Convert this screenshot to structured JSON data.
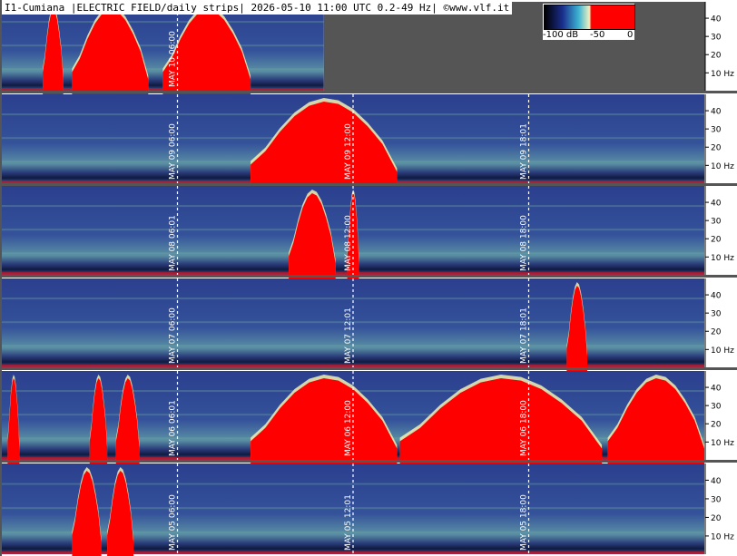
{
  "header": {
    "title": "I1-Cumiana |ELECTRIC FIELD/daily strips| 2026-05-10 11:00 UTC 0.2-49 Hz| ©www.vlf.it"
  },
  "colorbar": {
    "labels": [
      "-100 dB",
      "-50",
      "0"
    ],
    "colors": [
      "#000000",
      "#1a2e8c",
      "#3cb4d2",
      "#f0f0c0",
      "#ff0000"
    ]
  },
  "colors": {
    "page_bg": "#ffffff",
    "empty_fill": "#555555",
    "divider": "#555555",
    "axis_strip_bg": "#ffffff",
    "spectrogram_bg": "#2a3f8a",
    "noise_band": "#6fa8a0",
    "saturated": "#ff0000",
    "pale": "#f2f0b0",
    "dotted_marker": "#ffffff"
  },
  "chart_data": {
    "type": "heatmap",
    "description_units": "frequency Hz vs time UTC, one strip per day",
    "y_ticks": [
      "40",
      "30",
      "20",
      "10 Hz"
    ],
    "y_range_hz": [
      0.2,
      49
    ],
    "strips": [
      {
        "date": "MAY 10",
        "markers": [
          {
            "label": "MAY 10  06:00",
            "hour": 6
          }
        ],
        "visible_hours": [
          0,
          11
        ],
        "red_events": [
          [
            1.4,
            2.1
          ],
          [
            2.4,
            5.0
          ],
          [
            5.5,
            8.5
          ]
        ]
      },
      {
        "date": "MAY 09",
        "markers": [
          {
            "label": "MAY 09  06:00",
            "hour": 6
          },
          {
            "label": "MAY 09  12:00",
            "hour": 12
          },
          {
            "label": "MAY 09  18:01",
            "hour": 18
          }
        ],
        "visible_hours": [
          0,
          24
        ],
        "red_events": [
          [
            8.5,
            13.5
          ]
        ]
      },
      {
        "date": "MAY 08",
        "markers": [
          {
            "label": "MAY 08  06:01",
            "hour": 6
          },
          {
            "label": "MAY 08  12:00",
            "hour": 12
          },
          {
            "label": "MAY 08  18:00",
            "hour": 18
          }
        ],
        "visible_hours": [
          0,
          24
        ],
        "red_events": [
          [
            9.8,
            11.4
          ],
          [
            11.8,
            12.2
          ]
        ]
      },
      {
        "date": "MAY 07",
        "markers": [
          {
            "label": "MAY 07  06:00",
            "hour": 6
          },
          {
            "label": "MAY 07  12:01",
            "hour": 12
          },
          {
            "label": "MAY 07  18:01",
            "hour": 18
          }
        ],
        "visible_hours": [
          0,
          24
        ],
        "red_events": [
          [
            19.3,
            20.0
          ]
        ]
      },
      {
        "date": "MAY 06",
        "markers": [
          {
            "label": "MAY 06  06:01",
            "hour": 6
          },
          {
            "label": "MAY 06  12:00",
            "hour": 12
          },
          {
            "label": "MAY 06  18:00",
            "hour": 18
          }
        ],
        "visible_hours": [
          0,
          24
        ],
        "red_events": [
          [
            0.2,
            0.6
          ],
          [
            3.0,
            3.6
          ],
          [
            3.9,
            4.7
          ],
          [
            8.5,
            13.5
          ],
          [
            13.6,
            20.5
          ],
          [
            20.7,
            24.0
          ]
        ]
      },
      {
        "date": "MAY 05",
        "markers": [
          {
            "label": "MAY 05  06:00",
            "hour": 6
          },
          {
            "label": "MAY 05  12:01",
            "hour": 12
          },
          {
            "label": "MAY 05  18:00",
            "hour": 18
          }
        ],
        "visible_hours": [
          0,
          24
        ],
        "red_events": [
          [
            2.4,
            3.4
          ],
          [
            3.6,
            4.5
          ]
        ]
      }
    ]
  }
}
